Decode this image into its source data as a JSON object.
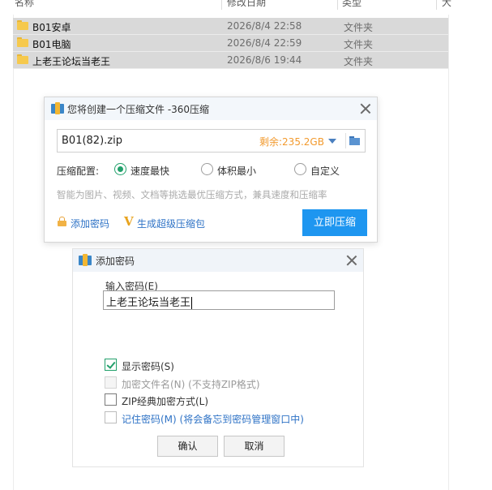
{
  "explorer": {
    "columns": {
      "name": "名称",
      "date": "修改日期",
      "type": "类型",
      "size": "大"
    },
    "files": [
      {
        "name": "B01安卓",
        "date": "2026/8/4 22:58",
        "type": "文件夹"
      },
      {
        "name": "B01电脑",
        "date": "2026/8/4 22:59",
        "type": "文件夹"
      },
      {
        "name": "上老王论坛当老王",
        "date": "2026/8/6 19:44",
        "type": "文件夹"
      }
    ]
  },
  "compress_dialog": {
    "title": "您将创建一个压缩文件 -360压缩",
    "filename": "B01(82).zip",
    "free_space": "剩余:235.2GB",
    "config_label": "压缩配置:",
    "options": [
      "速度最快",
      "体积最小",
      "自定义"
    ],
    "selected_option": "速度最快",
    "hint": "智能为图片、视频、文档等挑选最优压缩方式，兼具速度和压缩率",
    "add_password_link": "添加密码",
    "super_pack_link": "生成超级压缩包",
    "compress_button": "立即压缩",
    "accent_color": "#1e96f0"
  },
  "password_dialog": {
    "title": "添加密码",
    "input_label": "输入密码(E)",
    "password_value": "上老王论坛当老王",
    "checkboxes": [
      {
        "label": "显示密码(S)",
        "checked": true,
        "disabled": false
      },
      {
        "label": "加密文件名(N) (不支持ZIP格式)",
        "checked": false,
        "disabled": true
      },
      {
        "label": "ZIP经典加密方式(L)",
        "checked": false,
        "disabled": false
      },
      {
        "label": "记住密码(M) (将会备忘到密码管理窗口中)",
        "checked": false,
        "disabled": false
      }
    ],
    "ok_button": "确认",
    "cancel_button": "取消"
  }
}
